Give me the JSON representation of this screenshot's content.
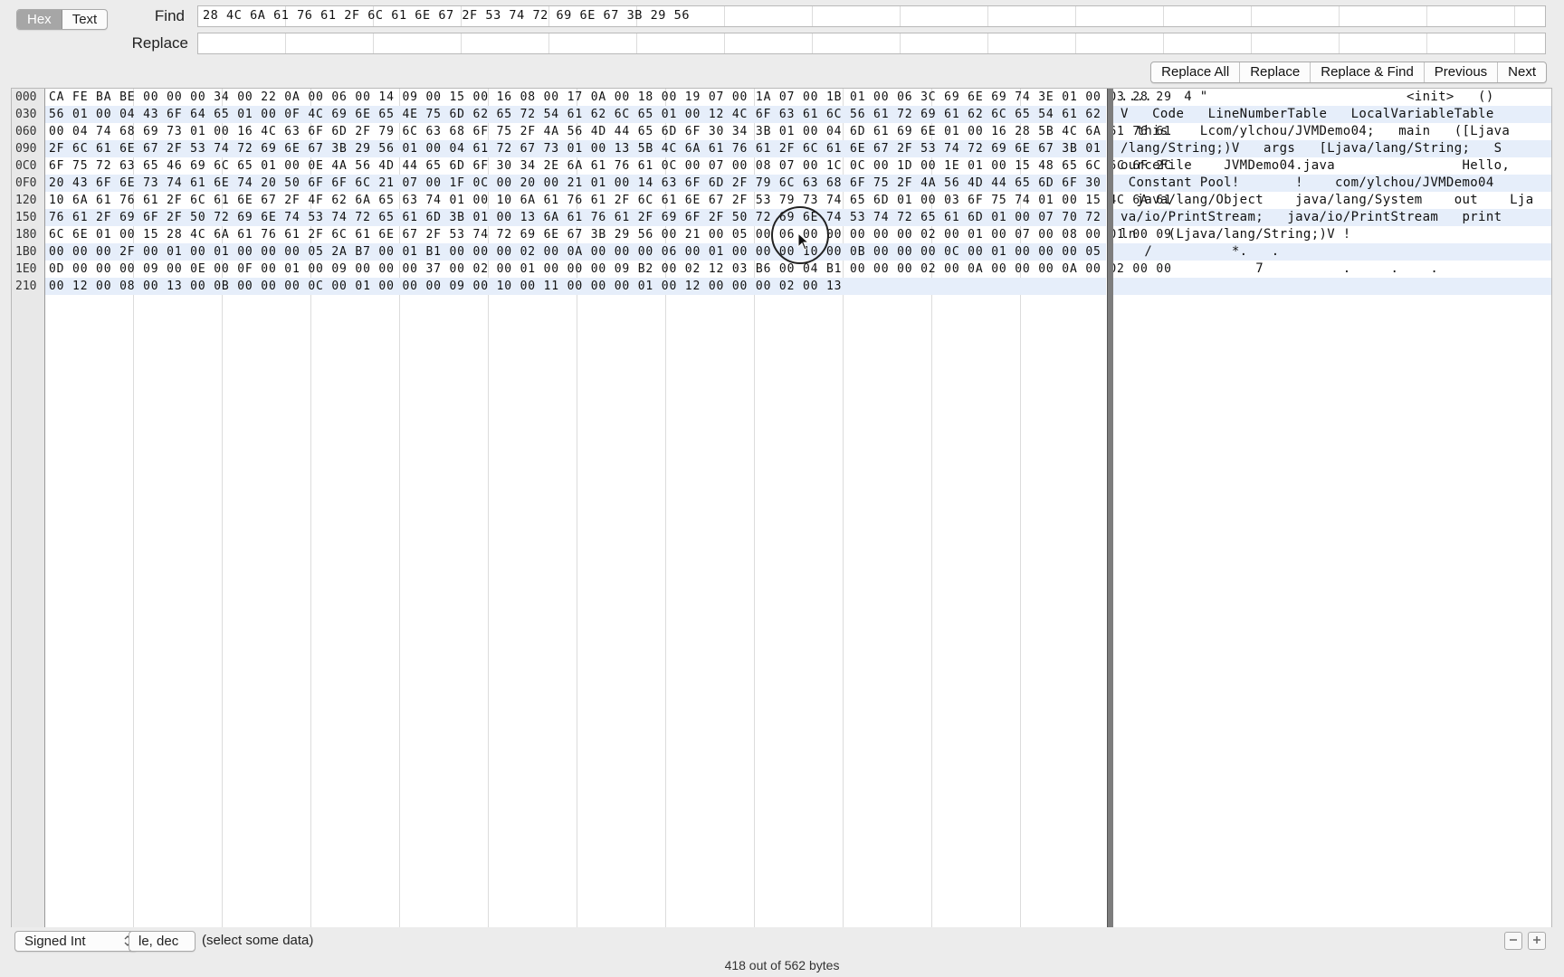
{
  "mode_toggle": {
    "hex": "Hex",
    "text": "Text"
  },
  "find": {
    "label": "Find",
    "value": "28 4C 6A 61 76 61 2F 6C 61 6E 67 2F 53 74 72 69 6E 67 3B 29 56"
  },
  "replace": {
    "label": "Replace",
    "value": ""
  },
  "buttons": {
    "replace_all": "Replace All",
    "replace": "Replace",
    "replace_find": "Replace & Find",
    "previous": "Previous",
    "next": "Next"
  },
  "line_numbers": [
    "000",
    "030",
    "060",
    "090",
    "0C0",
    "0F0",
    "120",
    "150",
    "180",
    "1B0",
    "1E0",
    "210"
  ],
  "hex_rows": [
    "CA FE BA BE 00 00 00 34 00 22 0A 00 06 00 14 09 00 15 00 16 08 00 17 0A 00 18 00 19 07 00 1A 07 00 1B 01 00 06 3C 69 6E 69 74 3E 01 00 03 28 29",
    "56 01 00 04 43 6F 64 65 01 00 0F 4C 69 6E 65 4E 75 6D 62 65 72 54 61 62 6C 65 01 00 12 4C 6F 63 61 6C 56 61 72 69 61 62 6C 65 54 61 62 6C 65 01",
    "00 04 74 68 69 73 01 00 16 4C 63 6F 6D 2F 79 6C 63 68 6F 75 2F 4A 56 4D 44 65 6D 6F 30 34 3B 01 00 04 6D 61 69 6E 01 00 16 28 5B 4C 6A 61 76 61",
    "2F 6C 61 6E 67 2F 53 74 72 69 6E 67 3B 29 56 01 00 04 61 72 67 73 01 00 13 5B 4C 6A 61 76 61 2F 6C 61 6E 67 2F 53 74 72 69 6E 67 3B 01 00 0A 53",
    "6F 75 72 63 65 46 69 6C 65 01 00 0E 4A 56 4D 44 65 6D 6F 30 34 2E 6A 61 76 61 0C 00 07 00 08 07 00 1C 0C 00 1D 00 1E 01 00 15 48 65 6C 6C 6F 2C",
    "20 43 6F 6E 73 74 61 6E 74 20 50 6F 6F 6C 21 07 00 1F 0C 00 20 00 21 01 00 14 63 6F 6D 2F 79 6C 63 68 6F 75 2F 4A 56 4D 44 65 6D 6F 30 34 01 00",
    "10 6A 61 76 61 2F 6C 61 6E 67 2F 4F 62 6A 65 63 74 01 00 10 6A 61 76 61 2F 6C 61 6E 67 2F 53 79 73 74 65 6D 01 00 03 6F 75 74 01 00 15 4C 6A 61",
    "76 61 2F 69 6F 2F 50 72 69 6E 74 53 74 72 65 61 6D 3B 01 00 13 6A 61 76 61 2F 69 6F 2F 50 72 69 6E 74 53 74 72 65 61 6D 01 00 07 70 72 69 6E 74",
    "6C 6E 01 00 15 28 4C 6A 61 76 61 2F 6C 61 6E 67 2F 53 74 72 69 6E 67 3B 29 56 00 21 00 05 00 06 00 00 00 00 00 02 00 01 00 07 00 08 00 01 00 09",
    "00 00 00 2F 00 01 00 01 00 00 00 05 2A B7 00 01 B1 00 00 00 02 00 0A 00 00 00 06 00 01 00 00 00 10 00 0B 00 00 00 0C 00 01 00 00 00 05 00 0C 00",
    "0D 00 00 00 09 00 0E 00 0F 00 01 00 09 00 00 00 37 00 02 00 01 00 00 00 09 B2 00 02 12 03 B6 00 04 B1 00 00 00 02 00 0A 00 00 00 0A 00 02 00 00",
    "00 12 00 08 00 13 00 0B 00 00 00 0C 00 01 00 00 00 09 00 10 00 11 00 00 00 01 00 12 00 00 00 02 00 13"
  ],
  "text_rows": [
    "....    4 \"                         <init>   ()",
    "V   Code   LineNumberTable   LocalVariableTable",
    "  this    Lcom/ylchou/JVMDemo04;   main   ([Ljava",
    "/lang/String;)V   args   [Ljava/lang/String;   S",
    "ourceFile    JVMDemo04.java                Hello,",
    " Constant Pool!       !    com/ylchou/JVMDemo04",
    "  java/lang/Object    java/lang/System    out    Lja",
    "va/io/PrintStream;   java/io/PrintStream   print",
    "ln    (Ljava/lang/String;)V !",
    "   /          *.   .",
    "                 7          .     .    .",
    ""
  ],
  "footer": {
    "type_select": "Signed Int",
    "endian_select": "le, dec",
    "status": "(select some data)",
    "byte_count": "418 out of 562 bytes"
  },
  "icons": {
    "minus": "minus-icon",
    "plus": "plus-icon",
    "updown": "updown-chevron-icon",
    "cursor": "mouse-pointer-icon"
  }
}
